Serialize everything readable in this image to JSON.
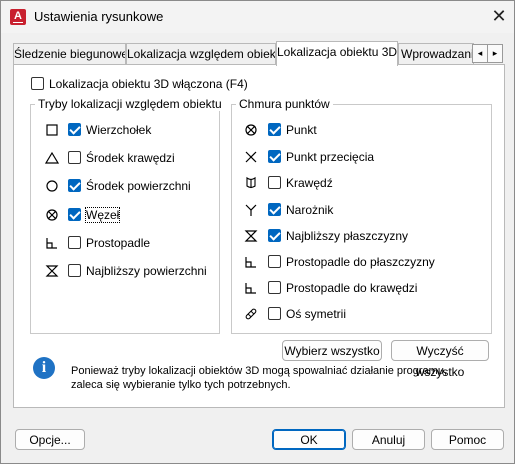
{
  "window": {
    "title": "Ustawienia rysunkowe",
    "app_icon_letter": "A"
  },
  "tabs": [
    {
      "label": "Śledzenie biegunowe",
      "active": false
    },
    {
      "label": "Lokalizacja względem obiektu",
      "active": false
    },
    {
      "label": "Lokalizacja obiektu 3D",
      "active": true
    },
    {
      "label": "Wprowadzanie",
      "active": false
    }
  ],
  "tab_scroll": {
    "left": "◂",
    "right": "▸"
  },
  "enable": {
    "label": "Lokalizacja obiektu 3D włączona (F4)",
    "checked": false
  },
  "left_group": {
    "title": "Tryby lokalizacji względem obiektu",
    "items": [
      {
        "label": "Wierzchołek",
        "checked": true,
        "icon": "square-icon"
      },
      {
        "label": "Środek krawędzi",
        "checked": false,
        "icon": "triangle-icon"
      },
      {
        "label": "Środek powierzchni",
        "checked": true,
        "icon": "circle-icon"
      },
      {
        "label": "Węzeł",
        "checked": true,
        "icon": "node-icon"
      },
      {
        "label": "Prostopadle",
        "checked": false,
        "icon": "perpendicular-icon"
      },
      {
        "label": "Najbliższy powierzchni",
        "checked": false,
        "icon": "nearest-icon"
      }
    ]
  },
  "right_group": {
    "title": "Chmura punktów",
    "items": [
      {
        "label": "Punkt",
        "checked": true,
        "icon": "node-icon"
      },
      {
        "label": "Punkt przecięcia",
        "checked": true,
        "icon": "intersection-icon"
      },
      {
        "label": "Krawędź",
        "checked": false,
        "icon": "edge-icon"
      },
      {
        "label": "Narożnik",
        "checked": true,
        "icon": "corner-icon"
      },
      {
        "label": "Najbliższy płaszczyzny",
        "checked": true,
        "icon": "nearest-icon"
      },
      {
        "label": "Prostopadle do płaszczyzny",
        "checked": false,
        "icon": "perpendicular-icon"
      },
      {
        "label": "Prostopadle do krawędzi",
        "checked": false,
        "icon": "perpendicular-icon"
      },
      {
        "label": "Oś symetrii",
        "checked": false,
        "icon": "axis-icon"
      }
    ]
  },
  "buttons": {
    "select_all": "Wybierz wszystko",
    "clear_all": "Wyczyść wszystko"
  },
  "info": {
    "line1": "Ponieważ tryby lokalizacji obiektów 3D mogą spowalniać działanie programu,",
    "line2": "zaleca się wybieranie tylko tych potrzebnych."
  },
  "footer": {
    "options": "Opcje...",
    "ok": "OK",
    "cancel": "Anuluj",
    "help": "Pomoc"
  }
}
